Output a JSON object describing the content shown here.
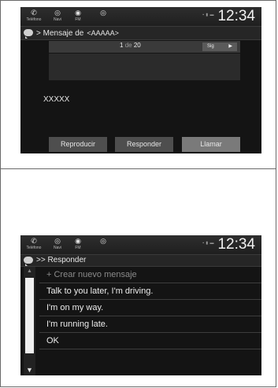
{
  "status_bar": {
    "icons": [
      {
        "icon": "phone-icon",
        "label": "Teléfono"
      },
      {
        "icon": "navi-icon",
        "label": "Navi"
      },
      {
        "icon": "radio-icon",
        "label": "FM"
      },
      {
        "icon": "audio-source-icon",
        "label": ""
      }
    ],
    "clock": "12:34"
  },
  "screen1": {
    "breadcrumb": "> Mensaje de",
    "sender": "<AAAAA>",
    "pager": {
      "current": "1",
      "of_label": "de",
      "total": "20",
      "next_label": "Sig"
    },
    "message_text": "XXXXX",
    "buttons": {
      "play": "Reproducir",
      "reply": "Responder",
      "call": "Llamar"
    }
  },
  "screen2": {
    "breadcrumb": ">> Responder",
    "items": [
      "+ Crear nuevo mensaje",
      "Talk to you later, I'm driving.",
      "I'm on my way.",
      "I'm running late.",
      "OK"
    ]
  }
}
